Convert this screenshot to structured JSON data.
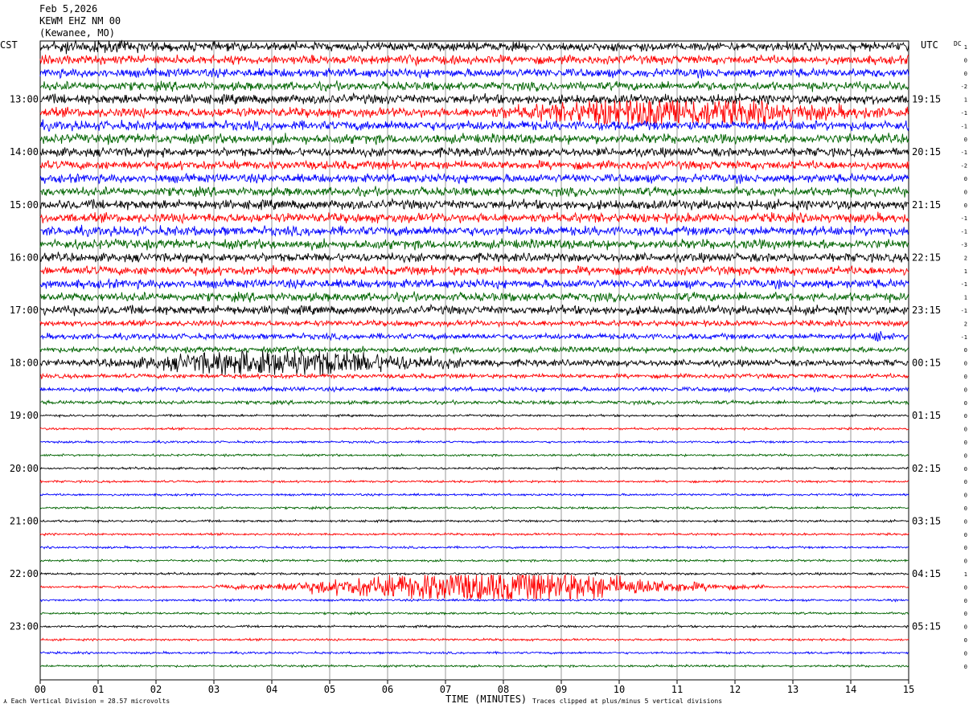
{
  "header": {
    "date": "Feb 5,2026",
    "station": "KEWM EHZ NM 00",
    "location": "(Kewanee, MO)"
  },
  "axis_labels": {
    "left_timezone": "CST",
    "right_timezone": "UTC",
    "dc_label": "DC",
    "xlabel": "TIME (MINUTES)"
  },
  "footer": {
    "vertical_division": "Each Vertical Division =   28.57 microvolts",
    "clip_note": "Traces clipped at plus/minus 5 vertical divisions"
  },
  "colors": {
    "trace_cycle": [
      "#000000",
      "#ff0000",
      "#0000ff",
      "#006400"
    ],
    "grid": "#999999",
    "background": "#ffffff"
  },
  "chart_data": {
    "type": "helicorder",
    "x_range_minutes": [
      0,
      15
    ],
    "x_ticks": [
      "00",
      "01",
      "02",
      "03",
      "04",
      "05",
      "06",
      "07",
      "08",
      "09",
      "10",
      "11",
      "12",
      "13",
      "14",
      "15"
    ],
    "minutes_per_line": 15,
    "line_count": 48,
    "left_hour_labels": [
      "13:00",
      "14:00",
      "15:00",
      "16:00",
      "17:00",
      "18:00",
      "19:00",
      "20:00",
      "21:00",
      "22:00",
      "23:00"
    ],
    "right_hour_labels": [
      "19:15",
      "20:15",
      "21:15",
      "22:15",
      "23:15",
      "00:15",
      "01:15",
      "02:15",
      "03:15",
      "04:15",
      "05:15"
    ],
    "hour_label_first_line": 4,
    "dc_offsets": [
      1,
      0,
      0,
      -2,
      1,
      -1,
      -1,
      0,
      -1,
      -2,
      0,
      0,
      0,
      -1,
      -1,
      -3,
      2,
      1,
      -1,
      1,
      -1,
      2,
      -1,
      0,
      0,
      0,
      0,
      0,
      0,
      0,
      0,
      0,
      0,
      0,
      0,
      0,
      0,
      0,
      0,
      0,
      1,
      0,
      0,
      0,
      0,
      0,
      0,
      0
    ],
    "noise_levels": [
      1.2,
      1.2,
      1.2,
      1.2,
      1.3,
      1.3,
      1.3,
      1.3,
      1.2,
      1.2,
      1.2,
      1.2,
      1.3,
      1.3,
      1.3,
      1.3,
      1.2,
      1.2,
      1.2,
      1.2,
      1.2,
      0.8,
      0.8,
      0.8,
      0.9,
      0.6,
      0.6,
      0.5,
      0.3,
      0.3,
      0.3,
      0.3,
      0.3,
      0.3,
      0.3,
      0.3,
      0.3,
      0.3,
      0.3,
      0.3,
      0.3,
      0.3,
      0.3,
      0.3,
      0.3,
      0.3,
      0.3,
      0.3
    ],
    "events": [
      {
        "line": 5,
        "start_min": 7.5,
        "end_min": 15.0,
        "peak_min": 10.5,
        "amplitude_div": 3.5
      },
      {
        "line": 24,
        "start_min": 1.0,
        "end_min": 8.0,
        "peak_min": 4.0,
        "amplitude_div": 3.5
      },
      {
        "line": 41,
        "start_min": 3.0,
        "end_min": 12.5,
        "peak_min": 8.0,
        "amplitude_div": 5.0
      },
      {
        "line": 1,
        "start_min": 6.3,
        "end_min": 6.6,
        "peak_min": 6.45,
        "amplitude_div": 1.2
      },
      {
        "line": 22,
        "start_min": 14.3,
        "end_min": 14.7,
        "peak_min": 14.5,
        "amplitude_div": 1.2
      },
      {
        "line": 0,
        "start_min": 0.0,
        "end_min": 2.5,
        "peak_min": 0.3,
        "amplitude_div": 0.8
      }
    ],
    "vertical_division_microvolts": 28.57,
    "clip_divisions": 5
  }
}
